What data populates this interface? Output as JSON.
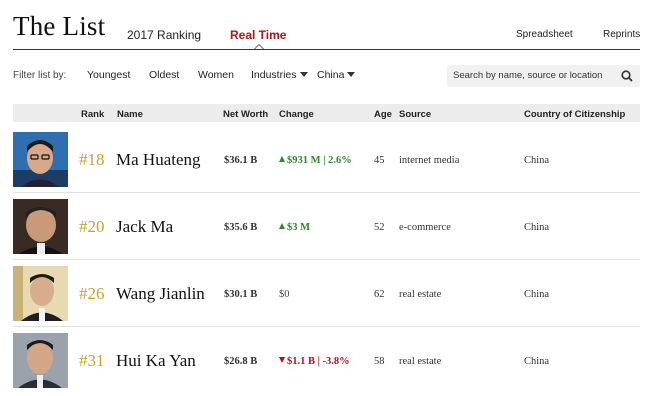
{
  "header": {
    "title": "The List",
    "tabs": [
      {
        "label": "2017 Ranking",
        "active": false
      },
      {
        "label": "Real Time",
        "active": true
      }
    ],
    "links": [
      "Spreadsheet",
      "Reprints"
    ],
    "accent_color": "#b31217"
  },
  "filters": {
    "label": "Filter list by:",
    "items": [
      "Youngest",
      "Oldest",
      "Women"
    ],
    "dropdowns": [
      "Industries",
      "China"
    ],
    "search_placeholder": "Search by name, source or location"
  },
  "table": {
    "columns": [
      "Rank",
      "Name",
      "Net Worth",
      "Change",
      "Age",
      "Source",
      "Country of Citizenship"
    ],
    "rows": [
      {
        "rank": "#18",
        "name": "Ma Huateng",
        "net_worth": "$36.1 B",
        "change": "$931 M | 2.6%",
        "trend": "up",
        "age": "45",
        "source": "internet media",
        "country": "China",
        "photo_icon": "person-photo-icon"
      },
      {
        "rank": "#20",
        "name": "Jack Ma",
        "net_worth": "$35.6 B",
        "change": "$3 M",
        "trend": "up",
        "age": "52",
        "source": "e-commerce",
        "country": "China",
        "photo_icon": "person-photo-icon"
      },
      {
        "rank": "#26",
        "name": "Wang Jianlin",
        "net_worth": "$30.1 B",
        "change": "$0",
        "trend": "flat",
        "age": "62",
        "source": "real estate",
        "country": "China",
        "photo_icon": "person-photo-icon"
      },
      {
        "rank": "#31",
        "name": "Hui Ka Yan",
        "net_worth": "$26.8 B",
        "change": "$1.1 B | -3.8%",
        "trend": "down",
        "age": "58",
        "source": "real estate",
        "country": "China",
        "photo_icon": "person-photo-icon"
      }
    ],
    "colors": {
      "rank": "#c9a233",
      "up": "#2b8a2b",
      "down": "#b31217"
    }
  }
}
